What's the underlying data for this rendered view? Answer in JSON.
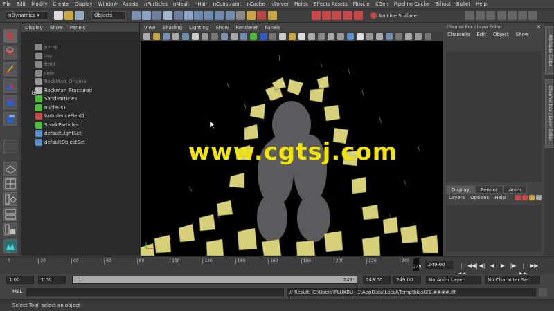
{
  "menubar": [
    "File",
    "Edit",
    "Modify",
    "Create",
    "Display",
    "Window",
    "Assets",
    "nParticles",
    "nMesh",
    "nHair",
    "nConstraint",
    "nCache",
    "nSolver",
    "Fields",
    "Effects Assets",
    "Muscle",
    "XGen",
    "Pipeline Cache",
    "Bifrost",
    "Bullet",
    "Help"
  ],
  "status": {
    "menuset": "nDynamics",
    "objects_label": "Objects",
    "live_surface": "No Live Surface"
  },
  "outliner": {
    "menu": [
      "Display",
      "Show",
      "Panels"
    ],
    "items": [
      "persp",
      "top",
      "front",
      "side",
      "RockMan_Original",
      "Rockman_Fractured",
      "SandParticles",
      "nucleus1",
      "turbulenceField1",
      "SparkParticles",
      "defaultLightSet",
      "defaultObjectSet"
    ]
  },
  "viewport": {
    "menu": [
      "View",
      "Shading",
      "Lighting",
      "Show",
      "Renderer",
      "Panels"
    ],
    "watermark": "www.cgtsj.com"
  },
  "channelbox": {
    "title": "Channel Box / Layer Editor",
    "menu": [
      "Channels",
      "Edit",
      "Object",
      "Show"
    ],
    "tabs": [
      "Display",
      "Render",
      "Anim"
    ],
    "layer_menu": [
      "Layers",
      "Options",
      "Help"
    ]
  },
  "side_tabs": [
    "Attribute Editor",
    "Channel Box / Layer Editor"
  ],
  "timeline": {
    "ticks": [
      "0",
      "20",
      "40",
      "60",
      "80",
      "100",
      "120",
      "140",
      "160",
      "180",
      "200",
      "220",
      "240"
    ],
    "current_frame": "249",
    "current_field": "249.00",
    "playback": [
      "|◀◀",
      "◀◀|",
      "◀|",
      "◀",
      "▶",
      "|▶",
      "|▶▶",
      "▶▶|"
    ]
  },
  "range": {
    "start": "1.00",
    "playback_start": "1.00",
    "slider_start": "1",
    "slider_end": "249",
    "playback_end": "249.00",
    "end": "249.00",
    "anim_layer": "No Anim Layer",
    "character_set": "No Character Set"
  },
  "command": {
    "label": "MEL",
    "result": "// Result: C:\\Users\\FLUXBU~1\\AppData\\Local\\Temp\\blast21.####.iff"
  },
  "help_line": "Select Tool: select an object",
  "colors": {
    "accent": "#f2e600",
    "rock": "#d6d07a",
    "viewport_bg": "#000000"
  }
}
